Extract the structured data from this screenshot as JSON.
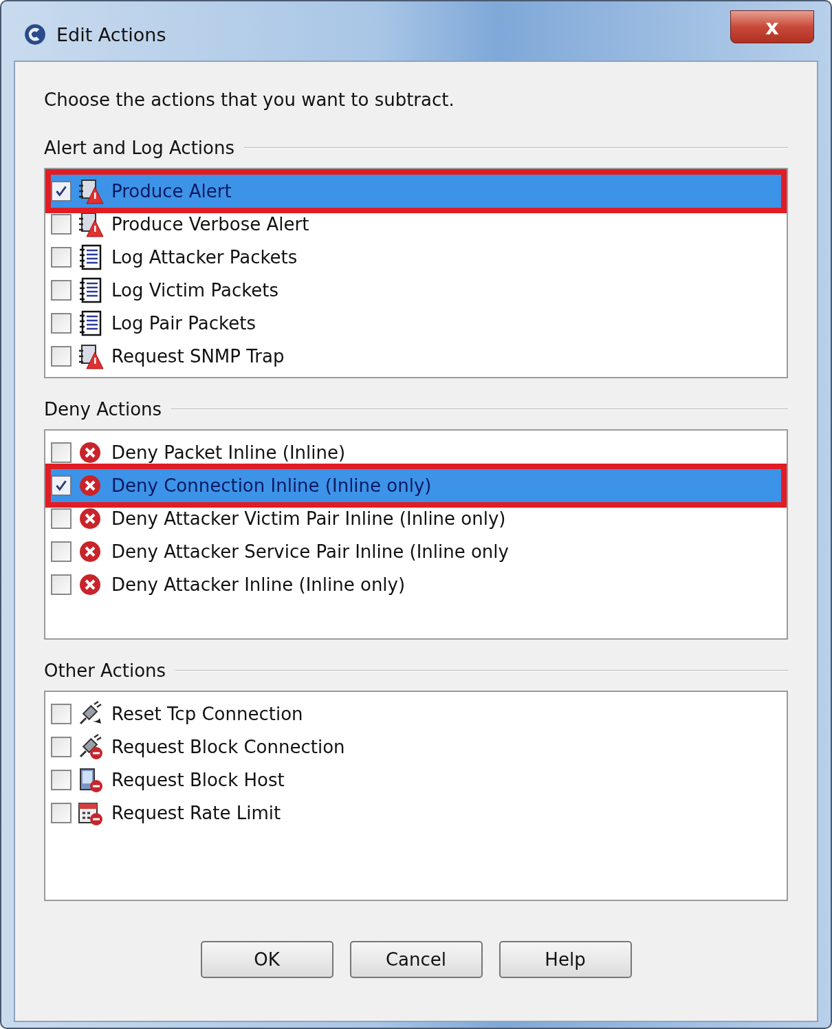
{
  "window": {
    "title": "Edit Actions",
    "close_label": "x"
  },
  "instruction": "Choose the actions that you want to subtract.",
  "groups": [
    {
      "title": "Alert and Log Actions",
      "items": [
        {
          "label": "Produce Alert",
          "kind": "alert",
          "checked": true,
          "selected": true,
          "annotated": true
        },
        {
          "label": "Produce Verbose Alert",
          "kind": "alert",
          "checked": false,
          "selected": false,
          "annotated": false
        },
        {
          "label": "Log Attacker Packets",
          "kind": "log",
          "checked": false,
          "selected": false,
          "annotated": false
        },
        {
          "label": "Log Victim Packets",
          "kind": "log",
          "checked": false,
          "selected": false,
          "annotated": false
        },
        {
          "label": "Log Pair Packets",
          "kind": "log",
          "checked": false,
          "selected": false,
          "annotated": false
        },
        {
          "label": "Request SNMP Trap",
          "kind": "alert",
          "checked": false,
          "selected": false,
          "annotated": false
        }
      ]
    },
    {
      "title": "Deny Actions",
      "items": [
        {
          "label": "Deny Packet Inline (Inline)",
          "kind": "deny",
          "checked": false,
          "selected": false,
          "annotated": false
        },
        {
          "label": "Deny Connection Inline (Inline only)",
          "kind": "deny",
          "checked": true,
          "selected": true,
          "annotated": true
        },
        {
          "label": "Deny Attacker Victim Pair Inline (Inline only)",
          "kind": "deny",
          "checked": false,
          "selected": false,
          "annotated": false
        },
        {
          "label": "Deny Attacker Service Pair Inline (Inline only",
          "kind": "deny",
          "checked": false,
          "selected": false,
          "annotated": false
        },
        {
          "label": "Deny Attacker Inline (Inline only)",
          "kind": "deny",
          "checked": false,
          "selected": false,
          "annotated": false
        }
      ]
    },
    {
      "title": "Other Actions",
      "items": [
        {
          "label": "Reset Tcp Connection",
          "kind": "reset",
          "checked": false,
          "selected": false,
          "annotated": false
        },
        {
          "label": "Request Block Connection",
          "kind": "block-connection",
          "checked": false,
          "selected": false,
          "annotated": false
        },
        {
          "label": "Request Block Host",
          "kind": "block-host",
          "checked": false,
          "selected": false,
          "annotated": false
        },
        {
          "label": "Request Rate Limit",
          "kind": "rate-limit",
          "checked": false,
          "selected": false,
          "annotated": false
        }
      ]
    }
  ],
  "buttons": [
    "OK",
    "Cancel",
    "Help"
  ]
}
